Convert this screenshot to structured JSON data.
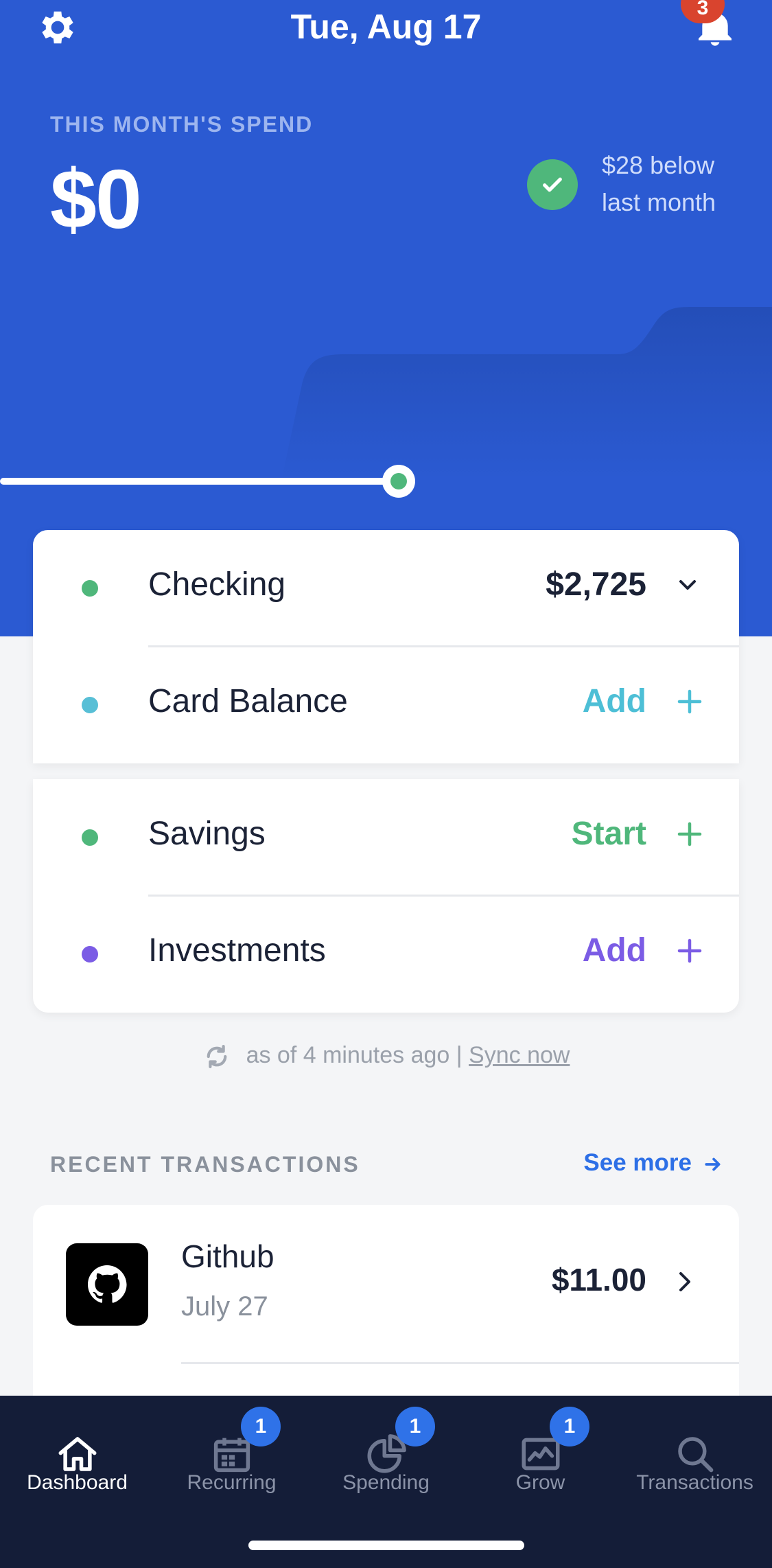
{
  "header": {
    "date": "Tue, Aug 17",
    "notification_count": "3"
  },
  "summary": {
    "label": "THIS MONTH'S SPEND",
    "amount": "$0",
    "comparison_line1": "$28 below",
    "comparison_line2": "last month",
    "status_color": "#4fb77b"
  },
  "accounts": [
    {
      "name": "Checking",
      "value": "$2,725",
      "action": "chevron-down",
      "dot_color": "#4fb77b",
      "value_color": "#1b2236"
    },
    {
      "name": "Card Balance",
      "value": "Add",
      "action": "plus",
      "dot_color": "#58bfd6",
      "value_color": "#4dbfd6"
    },
    {
      "name": "Savings",
      "value": "Start",
      "action": "plus",
      "dot_color": "#4fb77b",
      "value_color": "#4fb77b"
    },
    {
      "name": "Investments",
      "value": "Add",
      "action": "plus",
      "dot_color": "#7b5ce5",
      "value_color": "#7b5ce5"
    }
  ],
  "sync": {
    "status": "as of 4 minutes ago |",
    "link": "Sync now"
  },
  "recent": {
    "label": "RECENT TRANSACTIONS",
    "see_more": "See more",
    "transactions": [
      {
        "name": "Github",
        "date": "July 27",
        "amount": "$11.00",
        "icon": "github-icon"
      }
    ]
  },
  "tabs": [
    {
      "label": "Dashboard",
      "icon": "home-icon",
      "badge": "",
      "active": true
    },
    {
      "label": "Recurring",
      "icon": "calendar-icon",
      "badge": "1",
      "active": false
    },
    {
      "label": "Spending",
      "icon": "pie-chart-icon",
      "badge": "1",
      "active": false
    },
    {
      "label": "Grow",
      "icon": "growth-chart-icon",
      "badge": "1",
      "active": false
    },
    {
      "label": "Transactions",
      "icon": "search-icon",
      "badge": "",
      "active": false
    }
  ],
  "colors": {
    "brand_blue": "#2b5ad2",
    "link_blue": "#2d6fe6",
    "tabbar_bg": "#141d38",
    "badge_red": "#d9442e"
  }
}
